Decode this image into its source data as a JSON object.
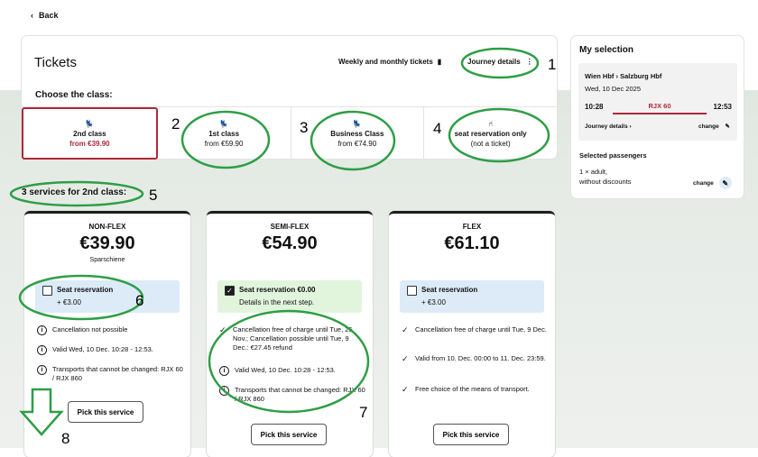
{
  "nav": {
    "back_label": "Back"
  },
  "tickets": {
    "title": "Tickets",
    "weekly_label": "Weekly and monthly tickets",
    "journey_label": "Journey details",
    "choose_label": "Choose the class:",
    "classes": [
      {
        "name": "2nd class",
        "price": "from €39.90",
        "selected": true
      },
      {
        "name": "1st class",
        "price": "from €59.90",
        "selected": false
      },
      {
        "name": "Business Class",
        "price": "from €74.90",
        "selected": false
      },
      {
        "name": "seat reservation only",
        "price": "(not a ticket)",
        "selected": false
      }
    ]
  },
  "services": {
    "title": "3 services for 2nd class:",
    "items": [
      {
        "name": "NON-FLEX",
        "price": "€39.90",
        "subtitle": "Sparschiene",
        "seat": {
          "line1": "Seat reservation",
          "line2": "+ €3.00",
          "checked": false
        },
        "features": [
          {
            "icon": "info-icon",
            "text": "Cancellation not possible"
          },
          {
            "icon": "info-icon",
            "text": "Valid Wed, 10 Dec. 10:28 - 12:53."
          },
          {
            "icon": "info-icon",
            "text": "Transports that cannot be changed: RJX 60 / RJX 860"
          }
        ],
        "button": "Pick this service"
      },
      {
        "name": "SEMI-FLEX",
        "price": "€54.90",
        "subtitle": "",
        "seat": {
          "line1": "Seat reservation €0.00",
          "line2": "Details in the next step.",
          "checked": true
        },
        "features": [
          {
            "icon": "check-icon",
            "text": "Cancellation free of charge until Tue, 25 Nov.; Cancellation possible until Tue, 9 Dec.: €27.45 refund"
          },
          {
            "icon": "info-icon",
            "text": "Valid Wed, 10 Dec. 10:28 - 12:53."
          },
          {
            "icon": "info-icon",
            "text": "Transports that cannot be changed: RJX 60 / RJX 860"
          }
        ],
        "button": "Pick this service"
      },
      {
        "name": "FLEX",
        "price": "€61.10",
        "subtitle": "",
        "seat": {
          "line1": "Seat reservation",
          "line2": "+ €3.00",
          "checked": false
        },
        "features": [
          {
            "icon": "check-icon",
            "text": "Cancellation free of charge until Tue, 9 Dec."
          },
          {
            "icon": "check-icon",
            "text": "Valid from 10. Dec. 00:00 to 11. Dec. 23:59."
          },
          {
            "icon": "check-icon",
            "text": "Free choice of the means of transport."
          }
        ],
        "button": "Pick this service"
      }
    ]
  },
  "selection": {
    "title": "My selection",
    "route": "Wien Hbf › Salzburg Hbf",
    "date": "Wed, 10 Dec 2025",
    "dep": "10:28",
    "train": "RJX 60",
    "arr": "12:53",
    "journey_details": "Journey details ›",
    "change": "change",
    "passengers_title": "Selected passengers",
    "passenger_line1": "1 × adult,",
    "passenger_line2": "without discounts",
    "passenger_change": "change"
  },
  "annotations": [
    "1",
    "2",
    "3",
    "4",
    "5",
    "6",
    "7",
    "8"
  ],
  "colors": {
    "accent": "#b0283a",
    "annotation": "#2e9e45",
    "number": "#2f43a3",
    "seat_blue": "#dcebf7",
    "seat_green": "#e1f5dd"
  }
}
